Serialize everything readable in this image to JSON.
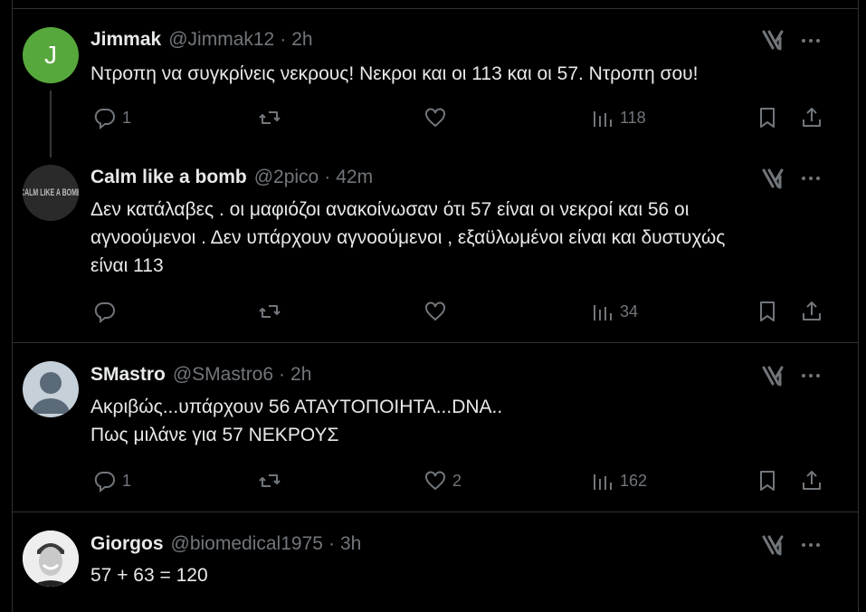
{
  "tweets": [
    {
      "name": "Jimmak",
      "handle": "@Jimmak12",
      "time": "2h",
      "avatar_letter": "J",
      "avatar_color": "#57a83c",
      "lines": [
        "Ντροπη να συγκρίνεις νεκρους! Νεκροι και οι 113 και οι 57. Ντροπη σου!"
      ],
      "counts": {
        "replies": "1",
        "retweets": "",
        "likes": "",
        "views": "118"
      }
    },
    {
      "name": "Calm like a bomb",
      "handle": "@2pico",
      "time": "42m",
      "avatar_text": "CALM LIKE A BOMB",
      "lines": [
        "Δεν κατάλαβες . οι μαφιόζοι ανακοίνωσαν ότι 57 είναι οι νεκροί και 56 οι",
        "αγνοούμενοι . Δεν υπάρχουν αγνοούμενοι , εξαϋλωμένοι είναι και δυστυχώς",
        "είναι 113"
      ],
      "counts": {
        "replies": "",
        "retweets": "",
        "likes": "",
        "views": "34"
      }
    },
    {
      "name": "SMastro",
      "handle": "@SMastro6",
      "time": "2h",
      "lines": [
        "Ακριβώς...υπάρχουν 56 ΑΤΑΥΤΟΠΟΙΗΤΑ...DNA..",
        "Πως μιλάνε για 57 ΝΕΚΡΟΥΣ"
      ],
      "counts": {
        "replies": "1",
        "retweets": "",
        "likes": "2",
        "views": "162"
      }
    },
    {
      "name": "Giorgos",
      "handle": "@biomedical1975",
      "time": "3h",
      "lines": [
        "57 + 63 = 120"
      ]
    }
  ],
  "icons": {
    "reply": "reply-icon",
    "retweet": "retweet-icon",
    "like": "like-icon",
    "views": "views-icon",
    "bookmark": "bookmark-icon",
    "share": "share-icon",
    "grok": "grok-icon",
    "more": "more-icon"
  },
  "colors": {
    "background": "#000000",
    "text": "#e7e9ea",
    "muted": "#71767b",
    "border": "#2f3336"
  }
}
